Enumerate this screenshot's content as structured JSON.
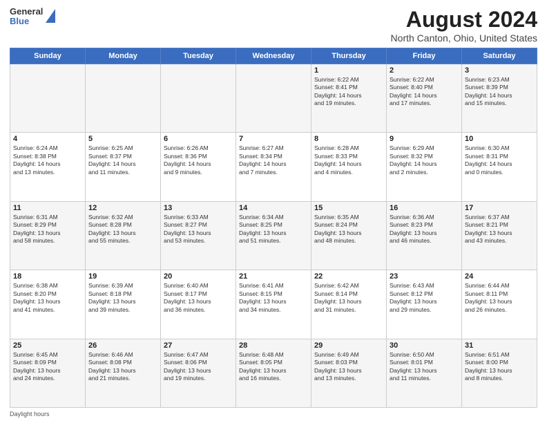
{
  "logo": {
    "general": "General",
    "blue": "Blue"
  },
  "title": "August 2024",
  "subtitle": "North Canton, Ohio, United States",
  "headers": [
    "Sunday",
    "Monday",
    "Tuesday",
    "Wednesday",
    "Thursday",
    "Friday",
    "Saturday"
  ],
  "weeks": [
    [
      {
        "day": "",
        "info": ""
      },
      {
        "day": "",
        "info": ""
      },
      {
        "day": "",
        "info": ""
      },
      {
        "day": "",
        "info": ""
      },
      {
        "day": "1",
        "info": "Sunrise: 6:22 AM\nSunset: 8:41 PM\nDaylight: 14 hours\nand 19 minutes."
      },
      {
        "day": "2",
        "info": "Sunrise: 6:22 AM\nSunset: 8:40 PM\nDaylight: 14 hours\nand 17 minutes."
      },
      {
        "day": "3",
        "info": "Sunrise: 6:23 AM\nSunset: 8:39 PM\nDaylight: 14 hours\nand 15 minutes."
      }
    ],
    [
      {
        "day": "4",
        "info": "Sunrise: 6:24 AM\nSunset: 8:38 PM\nDaylight: 14 hours\nand 13 minutes."
      },
      {
        "day": "5",
        "info": "Sunrise: 6:25 AM\nSunset: 8:37 PM\nDaylight: 14 hours\nand 11 minutes."
      },
      {
        "day": "6",
        "info": "Sunrise: 6:26 AM\nSunset: 8:36 PM\nDaylight: 14 hours\nand 9 minutes."
      },
      {
        "day": "7",
        "info": "Sunrise: 6:27 AM\nSunset: 8:34 PM\nDaylight: 14 hours\nand 7 minutes."
      },
      {
        "day": "8",
        "info": "Sunrise: 6:28 AM\nSunset: 8:33 PM\nDaylight: 14 hours\nand 4 minutes."
      },
      {
        "day": "9",
        "info": "Sunrise: 6:29 AM\nSunset: 8:32 PM\nDaylight: 14 hours\nand 2 minutes."
      },
      {
        "day": "10",
        "info": "Sunrise: 6:30 AM\nSunset: 8:31 PM\nDaylight: 14 hours\nand 0 minutes."
      }
    ],
    [
      {
        "day": "11",
        "info": "Sunrise: 6:31 AM\nSunset: 8:29 PM\nDaylight: 13 hours\nand 58 minutes."
      },
      {
        "day": "12",
        "info": "Sunrise: 6:32 AM\nSunset: 8:28 PM\nDaylight: 13 hours\nand 55 minutes."
      },
      {
        "day": "13",
        "info": "Sunrise: 6:33 AM\nSunset: 8:27 PM\nDaylight: 13 hours\nand 53 minutes."
      },
      {
        "day": "14",
        "info": "Sunrise: 6:34 AM\nSunset: 8:25 PM\nDaylight: 13 hours\nand 51 minutes."
      },
      {
        "day": "15",
        "info": "Sunrise: 6:35 AM\nSunset: 8:24 PM\nDaylight: 13 hours\nand 48 minutes."
      },
      {
        "day": "16",
        "info": "Sunrise: 6:36 AM\nSunset: 8:23 PM\nDaylight: 13 hours\nand 46 minutes."
      },
      {
        "day": "17",
        "info": "Sunrise: 6:37 AM\nSunset: 8:21 PM\nDaylight: 13 hours\nand 43 minutes."
      }
    ],
    [
      {
        "day": "18",
        "info": "Sunrise: 6:38 AM\nSunset: 8:20 PM\nDaylight: 13 hours\nand 41 minutes."
      },
      {
        "day": "19",
        "info": "Sunrise: 6:39 AM\nSunset: 8:18 PM\nDaylight: 13 hours\nand 39 minutes."
      },
      {
        "day": "20",
        "info": "Sunrise: 6:40 AM\nSunset: 8:17 PM\nDaylight: 13 hours\nand 36 minutes."
      },
      {
        "day": "21",
        "info": "Sunrise: 6:41 AM\nSunset: 8:15 PM\nDaylight: 13 hours\nand 34 minutes."
      },
      {
        "day": "22",
        "info": "Sunrise: 6:42 AM\nSunset: 8:14 PM\nDaylight: 13 hours\nand 31 minutes."
      },
      {
        "day": "23",
        "info": "Sunrise: 6:43 AM\nSunset: 8:12 PM\nDaylight: 13 hours\nand 29 minutes."
      },
      {
        "day": "24",
        "info": "Sunrise: 6:44 AM\nSunset: 8:11 PM\nDaylight: 13 hours\nand 26 minutes."
      }
    ],
    [
      {
        "day": "25",
        "info": "Sunrise: 6:45 AM\nSunset: 8:09 PM\nDaylight: 13 hours\nand 24 minutes."
      },
      {
        "day": "26",
        "info": "Sunrise: 6:46 AM\nSunset: 8:08 PM\nDaylight: 13 hours\nand 21 minutes."
      },
      {
        "day": "27",
        "info": "Sunrise: 6:47 AM\nSunset: 8:06 PM\nDaylight: 13 hours\nand 19 minutes."
      },
      {
        "day": "28",
        "info": "Sunrise: 6:48 AM\nSunset: 8:05 PM\nDaylight: 13 hours\nand 16 minutes."
      },
      {
        "day": "29",
        "info": "Sunrise: 6:49 AM\nSunset: 8:03 PM\nDaylight: 13 hours\nand 13 minutes."
      },
      {
        "day": "30",
        "info": "Sunrise: 6:50 AM\nSunset: 8:01 PM\nDaylight: 13 hours\nand 11 minutes."
      },
      {
        "day": "31",
        "info": "Sunrise: 6:51 AM\nSunset: 8:00 PM\nDaylight: 13 hours\nand 8 minutes."
      }
    ]
  ],
  "footer": {
    "daylight_label": "Daylight hours"
  }
}
